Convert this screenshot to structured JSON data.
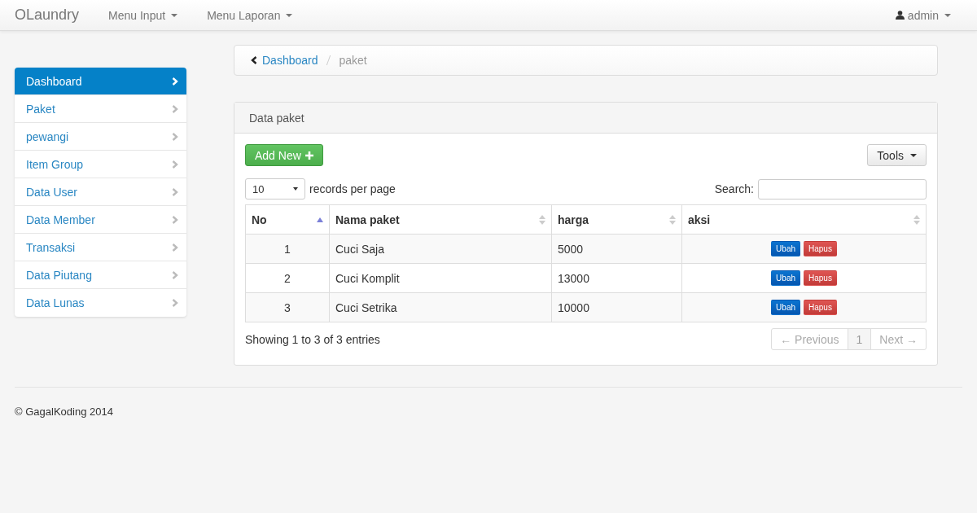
{
  "navbar": {
    "brand": "OLaundry",
    "menus": [
      {
        "label": "Menu Input"
      },
      {
        "label": "Menu Laporan"
      }
    ],
    "user": "admin"
  },
  "sidebar": {
    "items": [
      {
        "label": "Dashboard",
        "selected": true
      },
      {
        "label": "Paket",
        "selected": false
      },
      {
        "label": "pewangi",
        "selected": false
      },
      {
        "label": "Item Group",
        "selected": false
      },
      {
        "label": "Data User",
        "selected": false
      },
      {
        "label": "Data Member",
        "selected": false
      },
      {
        "label": "Transaksi",
        "selected": false
      },
      {
        "label": "Data Piutang",
        "selected": false
      },
      {
        "label": "Data Lunas",
        "selected": false
      }
    ]
  },
  "breadcrumb": {
    "link": "Dashboard",
    "current": "paket"
  },
  "panel": {
    "title": "Data paket",
    "add_button": "Add New",
    "tools_button": "Tools",
    "page_size": "10",
    "page_size_label": "records per page",
    "search_label": "Search:",
    "columns": [
      {
        "label": "No",
        "sorted": true
      },
      {
        "label": "Nama paket",
        "sorted": false
      },
      {
        "label": "harga",
        "sorted": false
      },
      {
        "label": "aksi",
        "sorted": false
      }
    ],
    "rows": [
      {
        "no": "1",
        "name": "Cuci Saja",
        "price": "5000",
        "edit": "Ubah",
        "delete": "Hapus"
      },
      {
        "no": "2",
        "name": "Cuci Komplit",
        "price": "13000",
        "edit": "Ubah",
        "delete": "Hapus"
      },
      {
        "no": "3",
        "name": "Cuci Setrika",
        "price": "10000",
        "edit": "Ubah",
        "delete": "Hapus"
      }
    ],
    "info": "Showing 1 to 3 of 3 entries",
    "pagination": [
      {
        "label": "← Previous",
        "disabled": true,
        "selected": false
      },
      {
        "label": "1",
        "disabled": false,
        "selected": true
      },
      {
        "label": "Next →",
        "disabled": true,
        "selected": false
      }
    ]
  },
  "footer": "© GagalKoding 2014"
}
